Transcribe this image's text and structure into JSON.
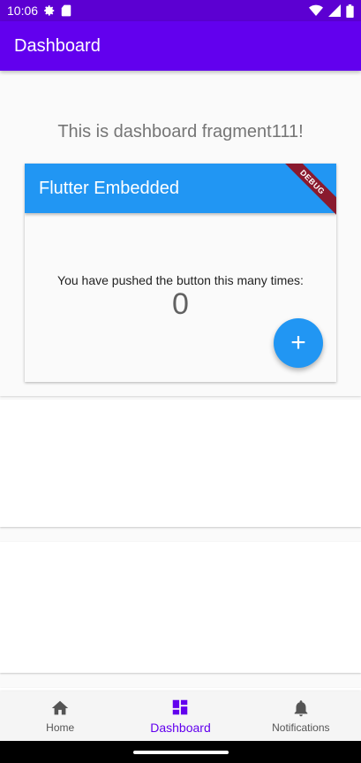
{
  "status_bar": {
    "time": "10:06",
    "icons": [
      "settings-icon",
      "sd-card-icon",
      "wifi-icon",
      "signal-icon",
      "battery-icon"
    ]
  },
  "app_bar": {
    "title": "Dashboard"
  },
  "fragment": {
    "text": "This is dashboard fragment111!"
  },
  "flutter": {
    "title": "Flutter Embedded",
    "debug_banner": "DEBUG",
    "push_text": "You have pushed the button this many times:",
    "counter": "0",
    "fab_label": "+"
  },
  "bottom_nav": {
    "items": [
      {
        "label": "Home",
        "icon": "home-icon",
        "active": false
      },
      {
        "label": "Dashboard",
        "icon": "dashboard-icon",
        "active": true
      },
      {
        "label": "Notifications",
        "icon": "bell-icon",
        "active": false
      }
    ]
  },
  "colors": {
    "status_bar": "#5c00d2",
    "app_bar": "#6200ee",
    "flutter_primary": "#2196f3",
    "debug_banner": "#8a1a2e",
    "nav_active": "#6200ee"
  }
}
